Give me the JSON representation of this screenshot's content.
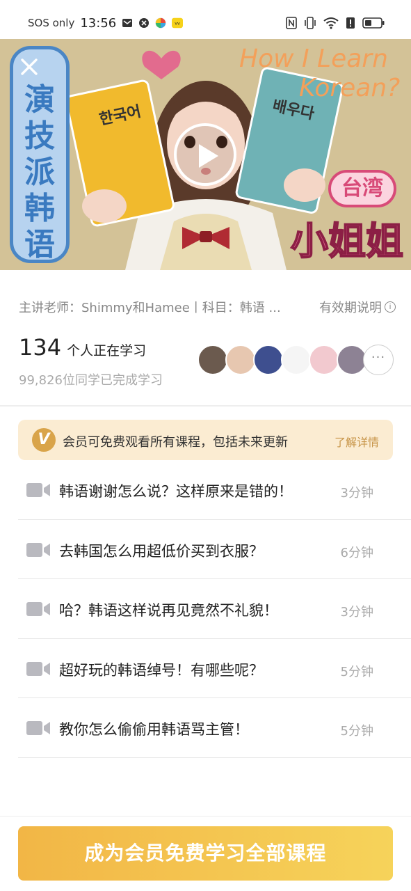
{
  "status_bar": {
    "sos": "SOS only",
    "time": "13:56"
  },
  "video": {
    "vertical_title": [
      "演",
      "技",
      "派",
      "韩",
      "语"
    ],
    "headline_line1": "How I Learn",
    "headline_line2": "Korean?",
    "book_left_label": "한국어",
    "book_right_label": "배우다",
    "tag": "台湾",
    "subtitle": "小姐姐"
  },
  "info": {
    "teacher_subject": "主讲老师：Shimmy和Hamee丨科目：韩语 ...",
    "validity_label": "有效期说明",
    "learning_count": "134",
    "learning_suffix": "个人正在学习",
    "completed": "99,826位同学已完成学习",
    "more_glyph": "···"
  },
  "vip": {
    "badge": "V",
    "text": "会员可免费观看所有课程，包括未来更新",
    "link": "了解详情"
  },
  "lessons": [
    {
      "title": "韩语谢谢怎么说？这样原来是错的！",
      "duration": "3分钟"
    },
    {
      "title": "去韩国怎么用超低价买到衣服？",
      "duration": "6分钟"
    },
    {
      "title": "哈？韩语这样说再见竟然不礼貌！",
      "duration": "3分钟"
    },
    {
      "title": "超好玩的韩语绰号！有哪些呢？",
      "duration": "5分钟"
    },
    {
      "title": "教你怎么偷偷用韩语骂主管！",
      "duration": "5分钟"
    }
  ],
  "cta": {
    "label": "成为会员免费学习全部课程"
  },
  "colors": {
    "accent_gold": "#f2b646",
    "vip_bg": "#fbecd2",
    "link_gold": "#c8964a"
  },
  "icons": [
    "close-icon",
    "play-icon",
    "video-camera-icon",
    "info-icon",
    "wifi-icon",
    "battery-icon",
    "nfc-icon",
    "vibrate-icon"
  ]
}
